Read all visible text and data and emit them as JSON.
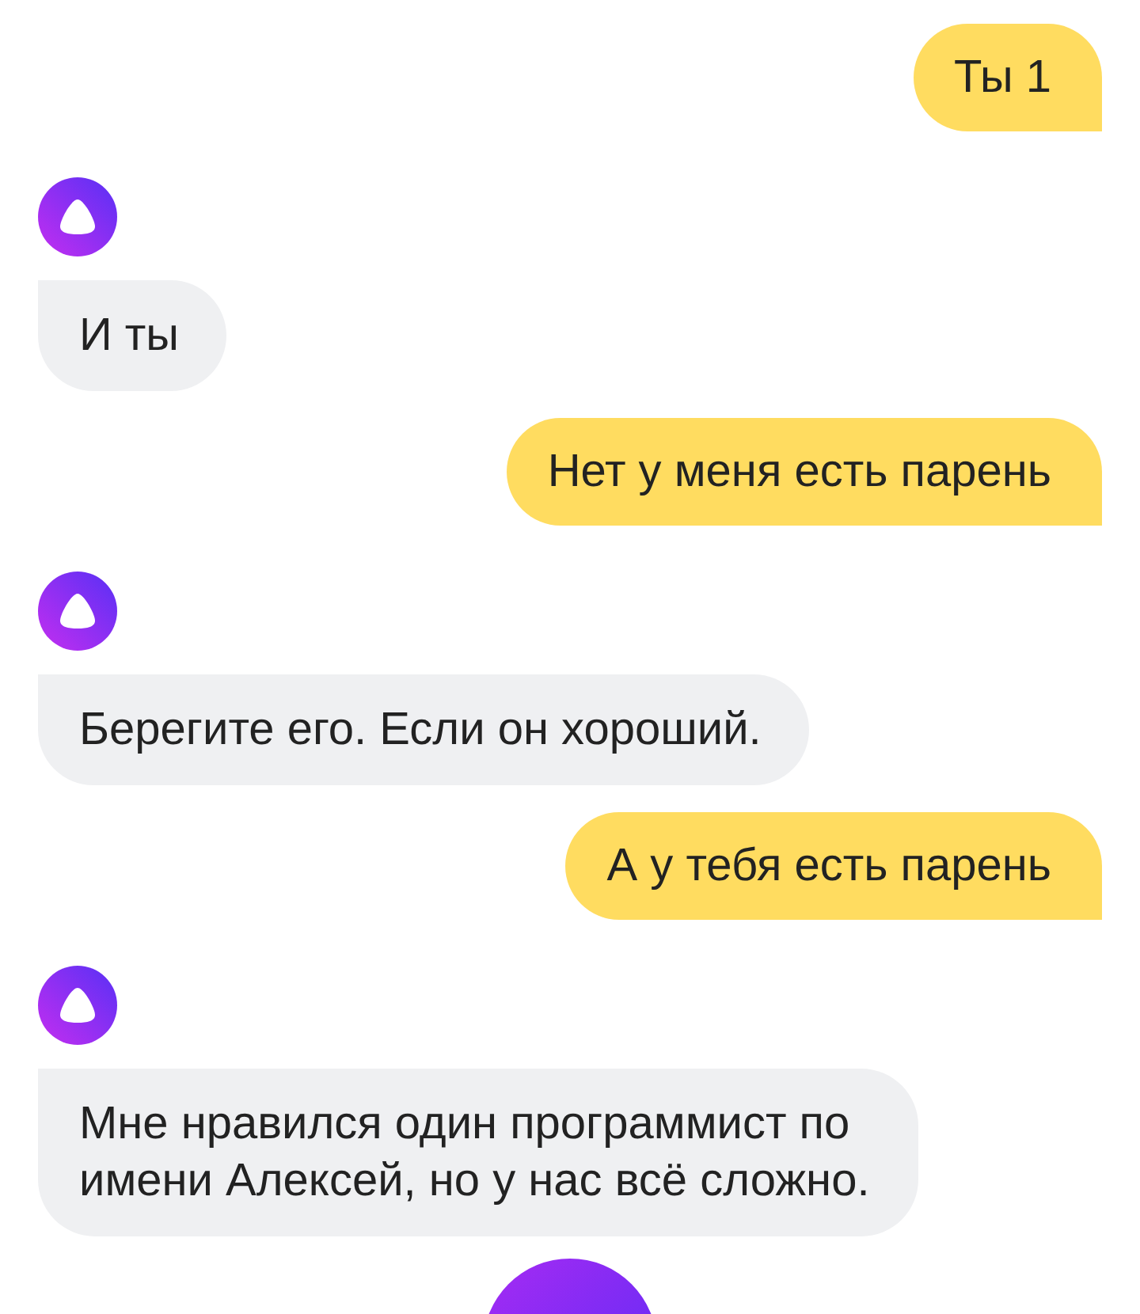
{
  "messages": [
    {
      "kind": "user",
      "text": "Ты 1"
    },
    {
      "kind": "bot",
      "text": "И ты"
    },
    {
      "kind": "user",
      "text": "Нет у меня есть парень"
    },
    {
      "kind": "bot",
      "text": "Берегите его. Если он хороший."
    },
    {
      "kind": "user",
      "text": "А у тебя есть парень"
    },
    {
      "kind": "bot",
      "text": "Мне нравился один программист по имени Алексей, но у нас всё сложно."
    }
  ]
}
